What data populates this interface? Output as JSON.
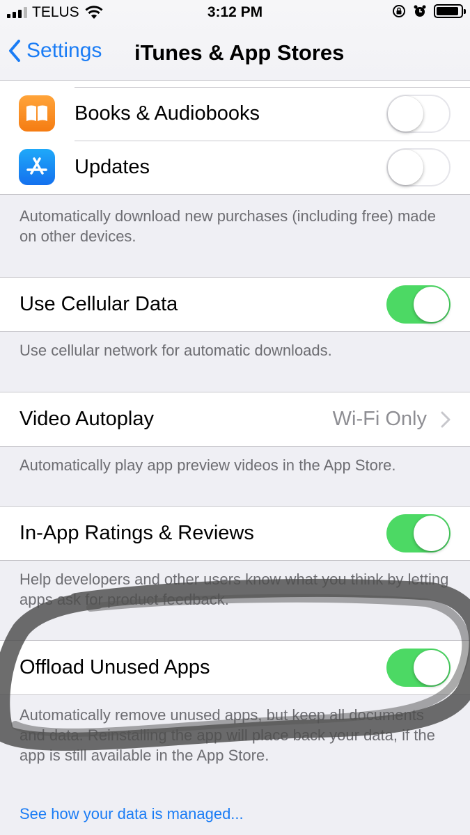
{
  "status_bar": {
    "carrier": "TELUS",
    "time": "3:12 PM",
    "icons": [
      "signal-icon",
      "wifi-icon",
      "rotation-lock-icon",
      "alarm-icon",
      "battery-icon"
    ]
  },
  "nav": {
    "back_label": "Settings",
    "title": "iTunes & App Stores"
  },
  "auto_downloads": {
    "items": [
      {
        "label": "Books & Audiobooks",
        "icon": "books-icon",
        "enabled": false
      },
      {
        "label": "Updates",
        "icon": "app-store-icon",
        "enabled": false
      }
    ],
    "footer": "Automatically download new purchases (including free) made on other devices."
  },
  "cellular": {
    "label": "Use Cellular Data",
    "enabled": true,
    "footer": "Use cellular network for automatic downloads."
  },
  "video_autoplay": {
    "label": "Video Autoplay",
    "value": "Wi-Fi Only",
    "footer": "Automatically play app preview videos in the App Store."
  },
  "ratings": {
    "label": "In-App Ratings & Reviews",
    "enabled": true,
    "footer": "Help developers and other users know what you think by letting apps ask for product feedback."
  },
  "offload": {
    "label": "Offload Unused Apps",
    "enabled": true,
    "footer": "Automatically remove unused apps, but keep all documents and data. Reinstalling the app will place back your data, if the app is still available in the App Store."
  },
  "data_link": "See how your data is managed...",
  "colors": {
    "accent": "#1a7cf5",
    "toggle_on": "#4cd964",
    "background": "#efeff4"
  }
}
